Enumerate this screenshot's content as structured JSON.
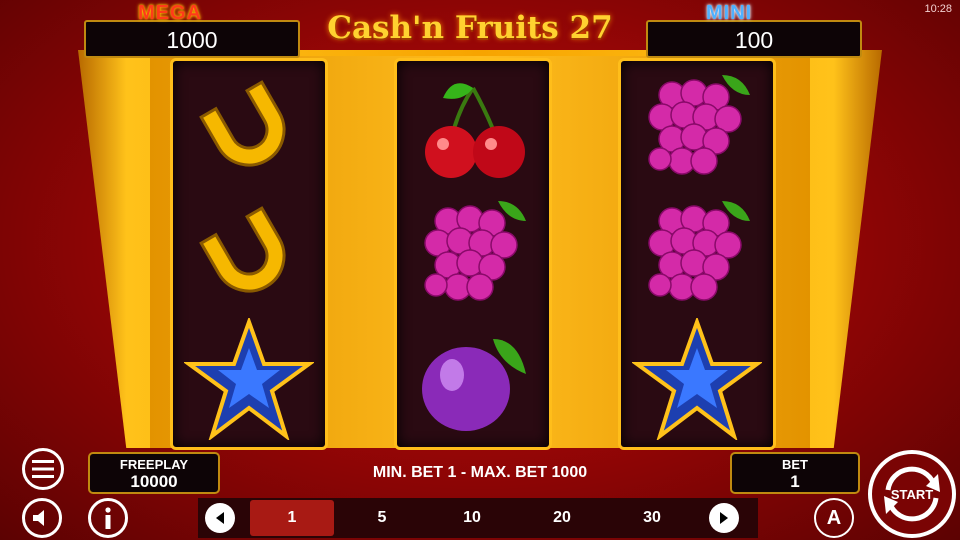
{
  "status": {
    "clock": "10:28"
  },
  "game": {
    "title": "Cash'n Fruits 27"
  },
  "jackpots": {
    "mega": {
      "label": "MEGA",
      "value": "1000"
    },
    "mini": {
      "label": "MINI",
      "value": "100"
    }
  },
  "reels": [
    [
      "horseshoe-icon",
      "horseshoe-icon",
      "blue-star-icon"
    ],
    [
      "cherry-icon",
      "grapes-icon",
      "plum-icon"
    ],
    [
      "grapes-icon",
      "grapes-icon",
      "blue-star-icon"
    ]
  ],
  "freeplay": {
    "label": "FREEPLAY",
    "value": "10000"
  },
  "bet_range": "MIN. BET 1 - MAX. BET 1000",
  "bet": {
    "label": "BET",
    "value": "1"
  },
  "bet_options": [
    "1",
    "5",
    "10",
    "20",
    "30"
  ],
  "selected_bet": "1",
  "start_label": "START",
  "auto_label": "A",
  "colors": {
    "frame_gold": "#ffc21a",
    "background_red": "#b00a0a",
    "selected_bet": "#a81a14"
  }
}
